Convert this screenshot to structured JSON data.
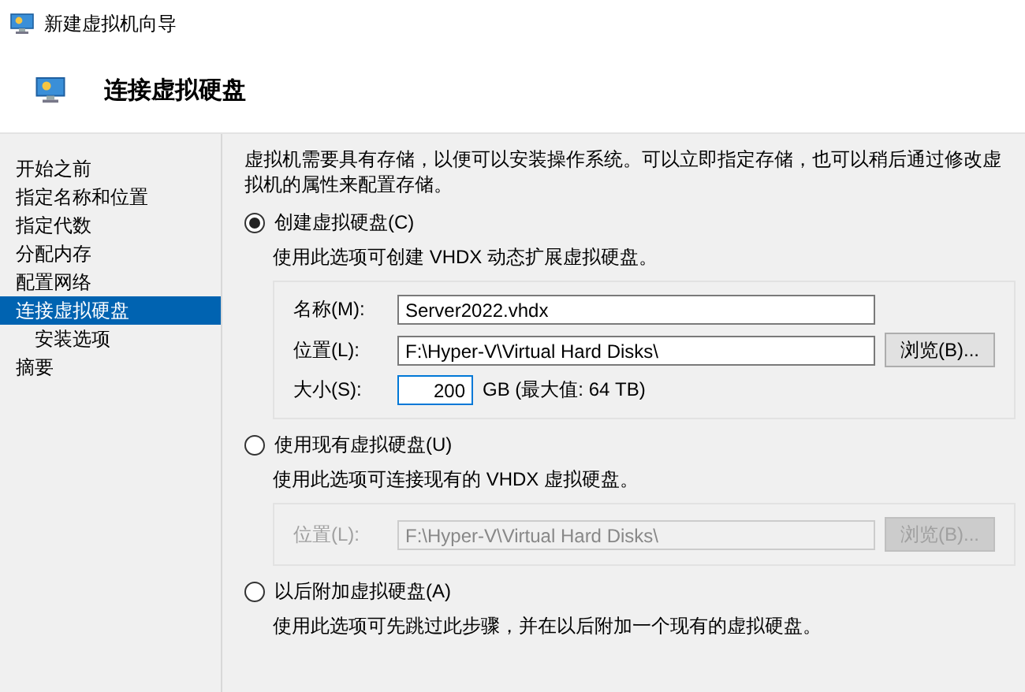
{
  "window": {
    "title": "新建虚拟机向导"
  },
  "header": {
    "title": "连接虚拟硬盘"
  },
  "sidebar": {
    "items": [
      {
        "label": "开始之前",
        "selected": false
      },
      {
        "label": "指定名称和位置",
        "selected": false
      },
      {
        "label": "指定代数",
        "selected": false
      },
      {
        "label": "分配内存",
        "selected": false
      },
      {
        "label": "配置网络",
        "selected": false
      },
      {
        "label": "连接虚拟硬盘",
        "selected": true,
        "children": [
          {
            "label": "安装选项",
            "selected": false
          }
        ]
      },
      {
        "label": "摘要",
        "selected": false
      }
    ]
  },
  "intro": "虚拟机需要具有存储，以便可以安装操作系统。可以立即指定存储，也可以稍后通过修改虚拟机的属性来配置存储。",
  "options": [
    {
      "label": "创建虚拟硬盘(C)",
      "selected": true,
      "description": "使用此选项可创建 VHDX 动态扩展虚拟硬盘。",
      "group": {
        "disabled": false,
        "fields": [
          {
            "kind": "text",
            "label": "名称(M):",
            "value": "Server2022.vhdx"
          },
          {
            "kind": "path",
            "label": "位置(L):",
            "value": "F:\\Hyper-V\\Virtual Hard Disks\\",
            "button": "浏览(B)..."
          },
          {
            "kind": "size",
            "label": "大小(S):",
            "value": "200",
            "focused": true,
            "suffix": "GB (最大值: 64 TB)"
          }
        ]
      }
    },
    {
      "label": "使用现有虚拟硬盘(U)",
      "selected": false,
      "description": "使用此选项可连接现有的 VHDX 虚拟硬盘。",
      "group": {
        "disabled": true,
        "fields": [
          {
            "kind": "path",
            "label": "位置(L):",
            "value": "F:\\Hyper-V\\Virtual Hard Disks\\",
            "button": "浏览(B)..."
          }
        ]
      }
    },
    {
      "label": "以后附加虚拟硬盘(A)",
      "selected": false,
      "description": "使用此选项可先跳过此步骤，并在以后附加一个现有的虚拟硬盘。"
    }
  ]
}
